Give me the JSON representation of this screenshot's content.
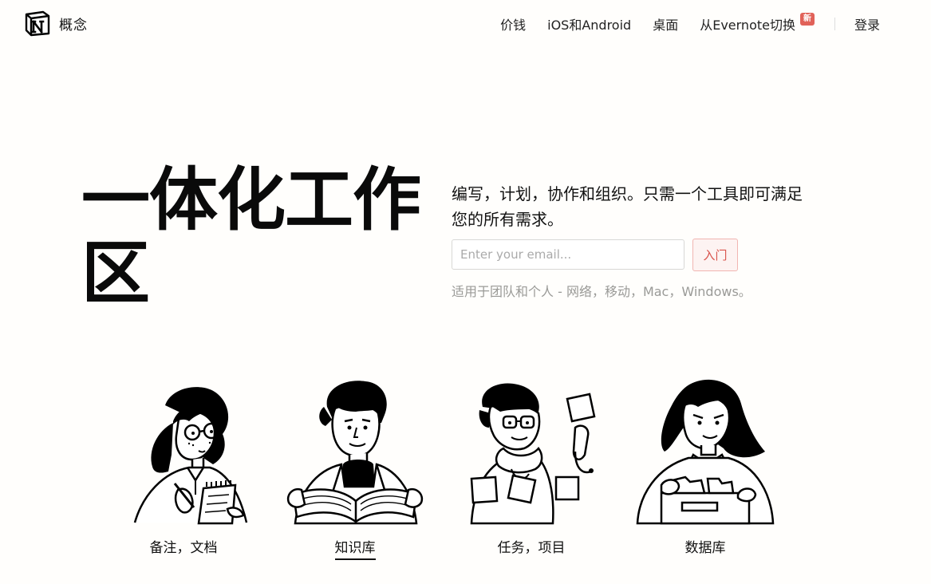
{
  "header": {
    "brand_name": "概念",
    "nav": [
      {
        "label": "价钱"
      },
      {
        "label": "iOS和Android"
      },
      {
        "label": "桌面"
      },
      {
        "label": "从Evernote切换",
        "badge": "新"
      }
    ],
    "login_label": "登录"
  },
  "hero": {
    "title": "一体化工作区",
    "subtitle": "编写，计划，协作和组织。只需一个工具即可满足您的所有需求。",
    "email_placeholder": "Enter your email...",
    "email_value": "",
    "start_button": "入门",
    "platforms": "适用于团队和个人 - 网络，移动，Mac，Windows。"
  },
  "features": [
    {
      "label": "备注，文档",
      "icon": "woman-writing-notes-illustration",
      "active": false
    },
    {
      "label": "知识库",
      "icon": "man-reading-book-illustration",
      "active": true
    },
    {
      "label": "任务，项目",
      "icon": "man-with-sticky-notes-illustration",
      "active": false
    },
    {
      "label": "数据库",
      "icon": "woman-with-file-box-illustration",
      "active": false
    }
  ],
  "colors": {
    "background": "#fffefc",
    "accent": "#e16259",
    "button_bg": "#fdf3f2",
    "button_border": "#f1b5b1",
    "muted_text": "#9a9a97"
  }
}
